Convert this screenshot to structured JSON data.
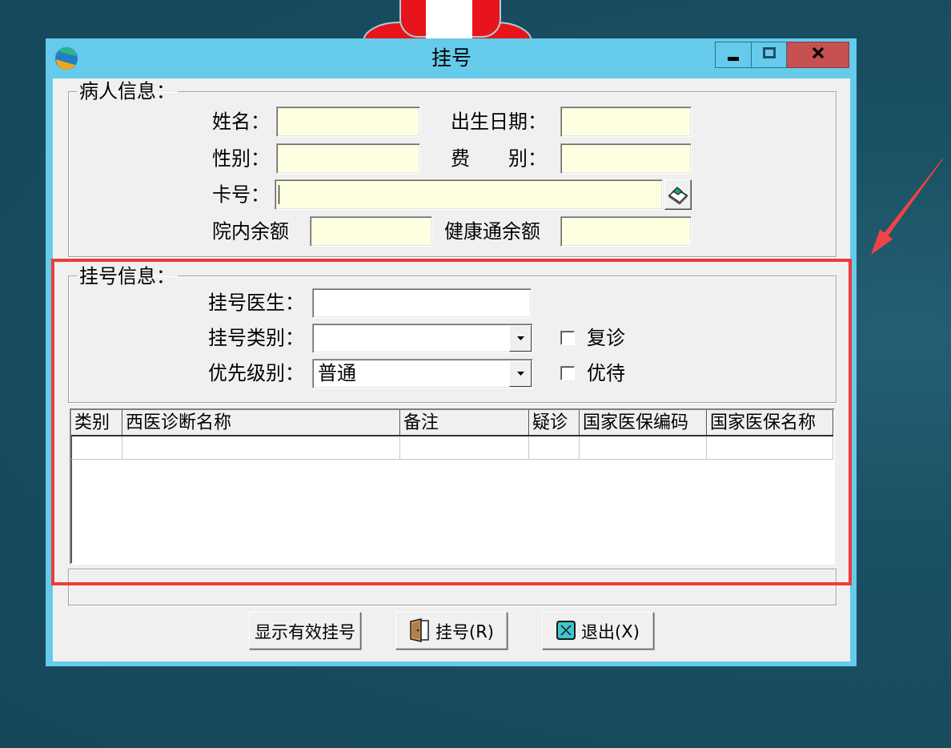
{
  "window": {
    "title": "挂号"
  },
  "patient_info": {
    "title": "病人信息：",
    "rows": [
      [
        {
          "kind": "text",
          "label": "姓名：",
          "focused": false
        },
        {
          "kind": "text",
          "label": "出生日期：",
          "focused": false
        }
      ],
      [
        {
          "kind": "text",
          "label": "性别：",
          "focused": false
        },
        {
          "kind": "text",
          "label": "费　　别：",
          "focused": false
        }
      ],
      [
        {
          "kind": "lookup",
          "label": "卡号：",
          "focused": true
        }
      ],
      [
        {
          "kind": "text",
          "label": "院内余额",
          "focused": false
        },
        {
          "kind": "text",
          "label": "健康通余额",
          "focused": false
        }
      ]
    ]
  },
  "registration_info": {
    "title": "挂号信息：",
    "fields": [
      {
        "kind": "text",
        "label": "挂号医生："
      },
      {
        "kind": "combo",
        "label": "挂号类别：",
        "checkbox": {
          "label": "复诊",
          "checked": false
        }
      },
      {
        "kind": "combo",
        "label": "优先级别：",
        "value": "普通",
        "checkbox": {
          "label": "优待",
          "checked": false
        }
      }
    ]
  },
  "diagnosis_table": {
    "columns": [
      "类别",
      "西医诊断名称",
      "备注",
      "疑诊",
      "国家医保编码",
      "国家医保名称"
    ]
  },
  "buttons": [
    {
      "kind": "plain",
      "label": "显示有效挂号"
    },
    {
      "kind": "register",
      "label": "挂号(R)"
    },
    {
      "kind": "exit",
      "label": "退出(X)"
    }
  ]
}
